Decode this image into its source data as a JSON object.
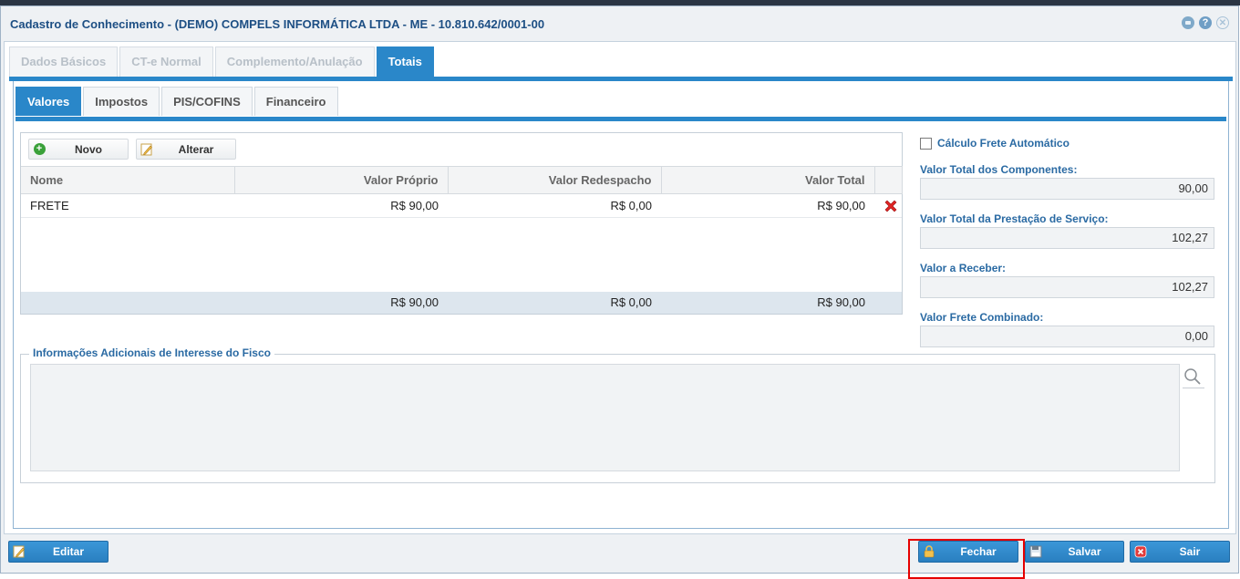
{
  "window": {
    "title": "Cadastro de Conhecimento - (DEMO) COMPELS INFORMÁTICA LTDA - ME - 10.810.642/0001-00"
  },
  "outer_tabs": [
    {
      "label": "Dados Básicos",
      "active": false
    },
    {
      "label": "CT-e Normal",
      "active": false
    },
    {
      "label": "Complemento/Anulação",
      "active": false
    },
    {
      "label": "Totais",
      "active": true
    }
  ],
  "inner_tabs": [
    {
      "label": "Valores",
      "active": true
    },
    {
      "label": "Impostos",
      "active": false
    },
    {
      "label": "PIS/COFINS",
      "active": false
    },
    {
      "label": "Financeiro",
      "active": false
    }
  ],
  "toolbar": {
    "novo_label": "Novo",
    "alterar_label": "Alterar"
  },
  "grid": {
    "columns": [
      "Nome",
      "Valor Próprio",
      "Valor Redespacho",
      "Valor Total"
    ],
    "rows": [
      {
        "nome": "FRETE",
        "valor_proprio": "R$ 90,00",
        "valor_redespacho": "R$ 0,00",
        "valor_total": "R$ 90,00"
      }
    ],
    "totals": {
      "valor_proprio": "R$ 90,00",
      "valor_redespacho": "R$ 0,00",
      "valor_total": "R$ 90,00"
    }
  },
  "right_panel": {
    "calculo_automatico_label": "Cálculo Frete Automático",
    "calculo_automatico_checked": false,
    "fields": [
      {
        "label": "Valor Total dos Componentes:",
        "value": "90,00"
      },
      {
        "label": "Valor Total da Prestação de Serviço:",
        "value": "102,27"
      },
      {
        "label": "Valor a Receber:",
        "value": "102,27"
      },
      {
        "label": "Valor Frete Combinado:",
        "value": "0,00"
      }
    ]
  },
  "info_adicional": {
    "legend": "Informações Adicionais de Interesse do Fisco",
    "value": ""
  },
  "bottom_bar": {
    "editar_label": "Editar",
    "fechar_label": "Fechar",
    "salvar_label": "Salvar",
    "sair_label": "Sair",
    "highlighted_button": "Fechar"
  },
  "colors": {
    "accent": "#2a87c9",
    "title": "#1d4f84",
    "label": "#2a6aa3",
    "highlight": "#e60000"
  }
}
